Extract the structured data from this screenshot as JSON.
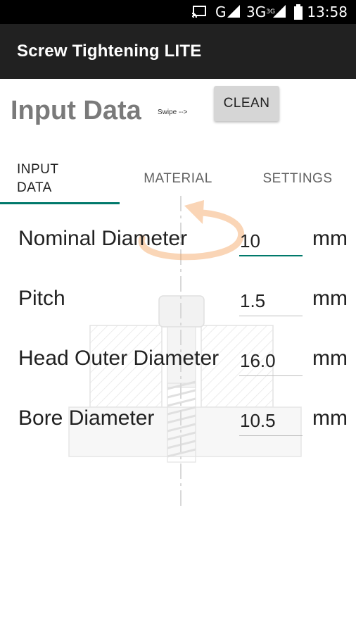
{
  "status_bar": {
    "network_label": "G",
    "network_3g": "3G",
    "network_3g_sup": "3G",
    "time": "13:58"
  },
  "app_bar": {
    "title": "Screw Tightening LITE"
  },
  "header": {
    "title": "Input Data",
    "swipe_hint": "Swipe -->",
    "clean_label": "CLEAN"
  },
  "tabs": [
    {
      "label": "INPUT\nDATA",
      "line1": "INPUT",
      "line2": "DATA",
      "active": true
    },
    {
      "label": "MATERIAL",
      "active": false
    },
    {
      "label": "SETTINGS",
      "active": false
    }
  ],
  "form": {
    "rows": [
      {
        "label": "Nominal Diameter",
        "value": "10",
        "unit": "mm",
        "focused": true
      },
      {
        "label": "Pitch",
        "value": "1.5",
        "unit": "mm",
        "focused": false
      },
      {
        "label": "Head Outer Diameter",
        "value": "16.0",
        "unit": "mm",
        "focused": false
      },
      {
        "label": "Bore Diameter",
        "value": "10.5",
        "unit": "mm",
        "focused": false
      }
    ]
  },
  "colors": {
    "accent": "#00796b",
    "app_bar": "#212121",
    "status_bar": "#000000",
    "heading": "#7a7a7a",
    "rotation_arrow": "#f4a460"
  },
  "icons": [
    "cast-icon",
    "signal-icon",
    "battery-icon",
    "rotation-arrow-icon"
  ]
}
